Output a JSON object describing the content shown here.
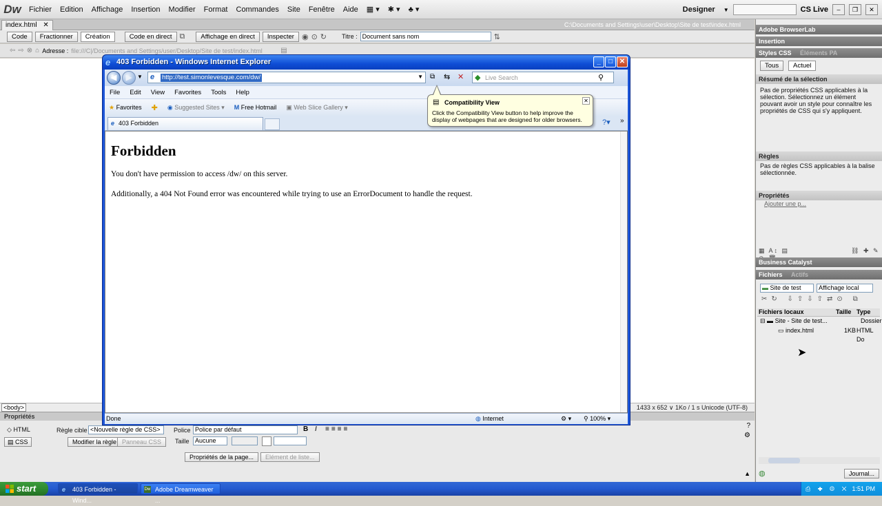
{
  "dreamweaver": {
    "logo": "Dw",
    "menus": [
      "Fichier",
      "Edition",
      "Affichage",
      "Insertion",
      "Modifier",
      "Format",
      "Commandes",
      "Site",
      "Fenêtre",
      "Aide"
    ],
    "workspace": "Designer",
    "cs_live": "CS Live",
    "document_tab": "index.html",
    "document_path": "C:\\Documents and Settings\\user\\Desktop\\Site de test\\index.html",
    "view_buttons": {
      "code": "Code",
      "split": "Fractionner",
      "design": "Création",
      "live_code": "Code en direct",
      "live_view": "Affichage en direct",
      "inspect": "Inspecter"
    },
    "title_label": "Titre :",
    "title_value": "Document sans nom",
    "address_label": "Adresse :",
    "address_value": "file:///C|/Documents and Settings/user/Desktop/Site de test/index.html",
    "status_body_tag": "<body>",
    "status_info": "1433 x 652 ∨ 1Ko / 1 s Unicode (UTF-8)",
    "properties": {
      "header": "Propriétés",
      "html_tab": "HTML",
      "css_tab": "CSS",
      "target_rule_label": "Règle cible",
      "target_rule_value": "<Nouvelle règle de CSS>",
      "font_label": "Police",
      "font_value": "Police par défaut",
      "size_label": "Taille",
      "size_value": "Aucune",
      "edit_rule_button": "Modifier la règle",
      "css_panel_button": "Panneau CSS",
      "page_props_button": "Propriétés de la page...",
      "list_item_button": "Elément de liste..."
    }
  },
  "panel": {
    "browserlab": "Adobe BrowserLab",
    "insertion": "Insertion",
    "css_styles": "Styles CSS",
    "ap_elements": "Éléments PA",
    "tab_all": "Tous",
    "tab_current": "Actuel",
    "summary_header": "Résumé de la sélection",
    "summary_text": "Pas de propriétés CSS applicables à la sélection. Sélectionnez un élément pouvant avoir un style pour connaître les propriétés de CSS qui s'y appliquent.",
    "rules_header": "Règles",
    "rules_text": "Pas de règles CSS applicables à la balise sélectionnée.",
    "props_header": "Propriétés",
    "add_property": "Ajouter une p...",
    "business_catalyst": "Business Catalyst",
    "files_tab": "Fichiers",
    "assets_tab": "Actifs",
    "site_select": "Site de test",
    "view_select": "Affichage local",
    "files_columns": [
      "Fichiers locaux",
      "Taille",
      "Type"
    ],
    "files_rows": [
      {
        "name": "Site - Site de test...",
        "size": "",
        "type": "Dossier"
      },
      {
        "name": "index.html",
        "size": "1KB",
        "type": "HTML Do"
      }
    ],
    "journal_button": "Journal..."
  },
  "ie": {
    "title": "403 Forbidden - Windows Internet Explorer",
    "url": "http://test.simonlevesque.com/dw/",
    "search_placeholder": "Live Search",
    "menus": [
      "File",
      "Edit",
      "View",
      "Favorites",
      "Tools",
      "Help"
    ],
    "favorites": {
      "favorites": "Favorites",
      "suggested": "Suggested Sites",
      "hotmail": "Free Hotmail",
      "slice": "Web Slice Gallery"
    },
    "tab_title": "403 Forbidden",
    "compat_title": "Compatibility View",
    "compat_body": "Click the Compatibility View button to help improve the display of webpages that are designed for older browsers.",
    "page_heading": "Forbidden",
    "page_p1": "You don't have permission to access /dw/ on this server.",
    "page_p2": "Additionally, a 404 Not Found error was encountered while trying to use an ErrorDocument to handle the request.",
    "status": "Done",
    "zone": "Internet",
    "zoom": "100%"
  },
  "taskbar": {
    "start": "start",
    "tasks": [
      "403 Forbidden - Wind...",
      "Adobe Dreamweaver ..."
    ],
    "clock": "1:51 PM"
  },
  "colors": {
    "ie_title": "#0f4ed6",
    "xp_taskbar": "#245ad0",
    "start_green": "#2f8a2f",
    "balloon": "#ffffe1"
  }
}
